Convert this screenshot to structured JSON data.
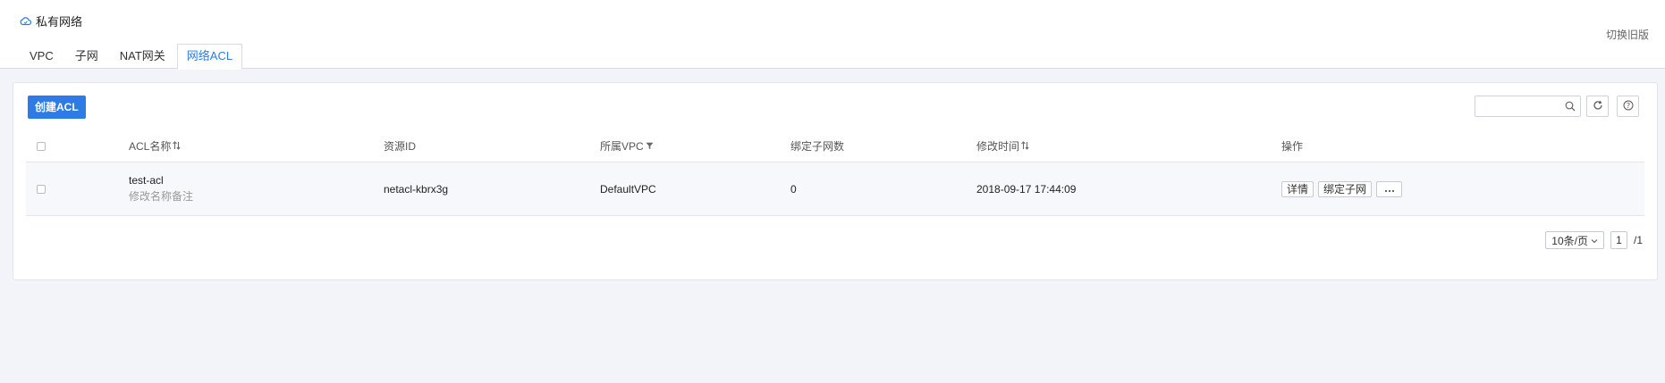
{
  "header": {
    "title": "私有网络",
    "switch_old": "切换旧版",
    "tabs": [
      {
        "label": "VPC",
        "active": false
      },
      {
        "label": "子网",
        "active": false
      },
      {
        "label": "NAT网关",
        "active": false
      },
      {
        "label": "网络ACL",
        "active": true
      }
    ]
  },
  "toolbar": {
    "create_label": "创建ACL",
    "search_placeholder": ""
  },
  "table": {
    "columns": {
      "name": "ACL名称",
      "resource_id": "资源ID",
      "vpc": "所属VPC",
      "subnet_count": "绑定子网数",
      "modified": "修改时间",
      "ops": "操作"
    },
    "rows": [
      {
        "name": "test-acl",
        "remark": "修改名称备注",
        "resource_id": "netacl-kbrx3g",
        "vpc": "DefaultVPC",
        "subnet_count": "0",
        "modified": "2018-09-17 17:44:09",
        "ops": {
          "detail": "详情",
          "bind": "绑定子网"
        }
      }
    ]
  },
  "pagination": {
    "page_size": "10条/页",
    "current": "1",
    "total": "/1"
  },
  "colors": {
    "accent": "#2d7be5",
    "background": "#f3f4f9"
  }
}
